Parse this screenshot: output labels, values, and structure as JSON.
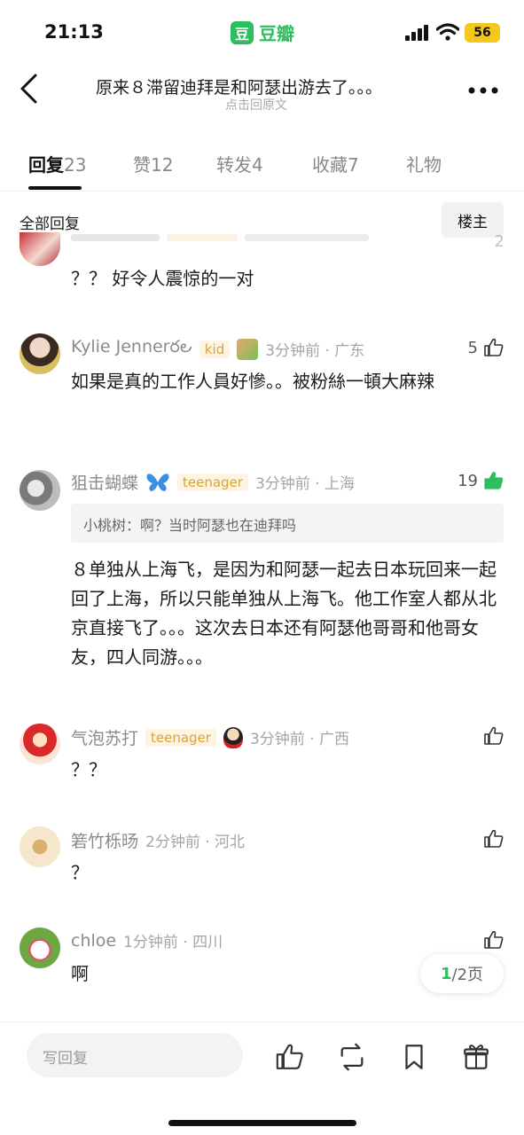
{
  "status": {
    "time": "21:13",
    "app_name": "豆瓣",
    "app_logo_char": "豆",
    "battery": "56"
  },
  "header": {
    "title": "原来８滞留迪拜是和阿瑟出游去了。。。",
    "subtitle": "点击回原文"
  },
  "tabs": [
    {
      "label": "回复",
      "count": "23"
    },
    {
      "label": "赞",
      "count": "12"
    },
    {
      "label": "转发",
      "count": "4"
    },
    {
      "label": "收藏",
      "count": "7"
    },
    {
      "label": "礼物",
      "count": ""
    }
  ],
  "filter": {
    "label": "全部回复",
    "owner_button": "楼主"
  },
  "comments": [
    {
      "text": "？？ 好令人震惊的一对",
      "likes": "2"
    },
    {
      "username": "Kylie Jenner",
      "name_suffix": "ర౿",
      "badge": "kid",
      "time_loc": "3分钟前 · 广东",
      "likes": "5",
      "text": "如果是真的工作人員好慘。。被粉絲一頓大麻辣"
    },
    {
      "username": "狙击蝴蝶",
      "badge": "teenager",
      "time_loc": "3分钟前 · 上海",
      "likes": "19",
      "quote": "小桃树：啊？当时阿瑟也在迪拜吗",
      "text": "８单独从上海飞，是因为和阿瑟一起去日本玩回来一起回了上海，所以只能单独从上海飞。他工作室人都从北京直接飞了。。。这次去日本还有阿瑟他哥哥和他哥女友，四人同游。。。"
    },
    {
      "username": "气泡苏打",
      "badge": "teenager",
      "time_loc": "3分钟前 · 广西",
      "likes": "",
      "text": "？？"
    },
    {
      "username": "箬竹栎旸",
      "time_loc": "2分钟前 · 河北",
      "likes": "",
      "text": "？"
    },
    {
      "username": "chloe",
      "time_loc": "1分钟前 · 四川",
      "likes": "",
      "text": "啊"
    }
  ],
  "pager": {
    "current": "1",
    "total": "/2页"
  },
  "bottom": {
    "reply_placeholder": "写回复"
  },
  "colors": {
    "accent": "#2dbe60",
    "badge_text": "#d8a33a",
    "badge_bg": "#fdf4e2"
  },
  "icons": [
    "back-icon",
    "more-icon",
    "thumb-up-icon",
    "repost-icon",
    "bookmark-icon",
    "gift-icon",
    "butterfly-icon",
    "signal-icon",
    "wifi-icon"
  ]
}
